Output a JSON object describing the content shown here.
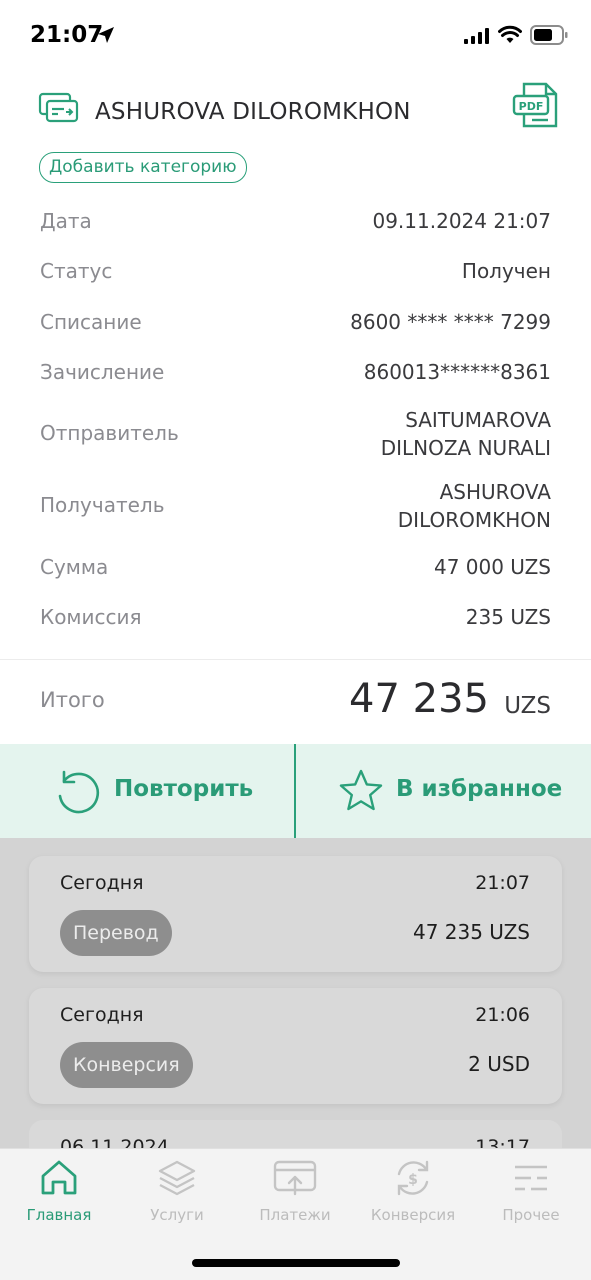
{
  "status_bar": {
    "time": "21:07"
  },
  "header": {
    "name": "ASHUROVA DILOROMKHON",
    "category_button": "Добавить категорию"
  },
  "details": [
    {
      "label": "Дата",
      "value": "09.11.2024 21:07"
    },
    {
      "label": "Статус",
      "value": "Получен"
    },
    {
      "label": "Списание",
      "value": "8600 **** **** 7299"
    },
    {
      "label": "Зачисление",
      "value": "860013******8361"
    },
    {
      "label": "Отправитель",
      "value_lines": [
        "SAITUMAROVA",
        "DILNOZA NURALI"
      ]
    },
    {
      "label": "Получатель",
      "value_lines": [
        "ASHUROVA",
        "DILOROMKHON"
      ]
    },
    {
      "label": "Сумма",
      "value": "47 000 UZS"
    },
    {
      "label": "Комиссия",
      "value": "235 UZS"
    }
  ],
  "total": {
    "label": "Итого",
    "amount": "47 235",
    "currency": "UZS"
  },
  "actions": {
    "repeat": "Повторить",
    "favorite": "В избранное"
  },
  "history": [
    {
      "date": "Сегодня",
      "time": "21:07",
      "type": "Перевод",
      "amount": "47 235 UZS"
    },
    {
      "date": "Сегодня",
      "time": "21:06",
      "type": "Конверсия",
      "amount": "2 USD"
    },
    {
      "date": "06.11.2024",
      "time": "13:17"
    }
  ],
  "tabs": [
    {
      "label": "Главная",
      "icon": "home-icon",
      "active": true
    },
    {
      "label": "Услуги",
      "icon": "layers-icon",
      "active": false
    },
    {
      "label": "Платежи",
      "icon": "card-payment-icon",
      "active": false
    },
    {
      "label": "Конверсия",
      "icon": "currency-exchange-icon",
      "active": false
    },
    {
      "label": "Прочее",
      "icon": "sliders-icon",
      "active": false
    }
  ],
  "colors": {
    "accent": "#2a9b77",
    "action_bg": "#e4f4ee",
    "overlay": "#d3d3d3"
  }
}
